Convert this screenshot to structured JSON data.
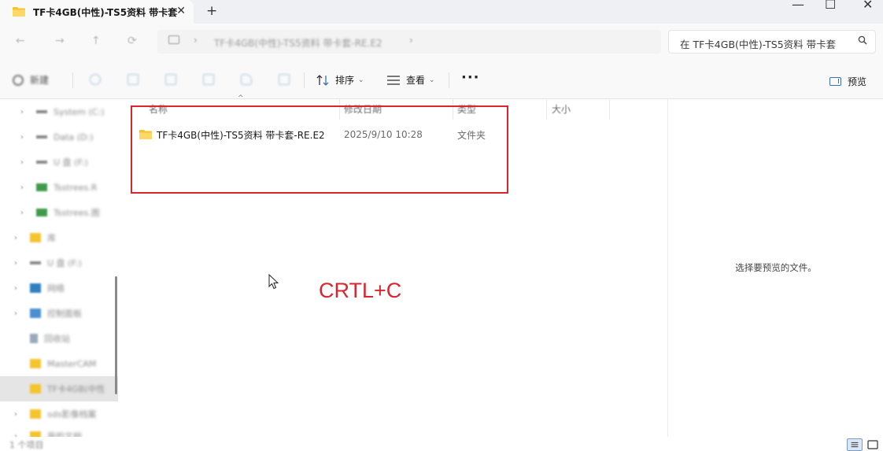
{
  "tab": {
    "title": "TF卡4GB(中性)-TS5资料 带卡套",
    "close": "✕",
    "new": "+"
  },
  "window_controls": {
    "minimize": "—",
    "maximize": "☐",
    "close": "✕"
  },
  "nav": {
    "back": "←",
    "forward": "→",
    "up": "↑",
    "refresh": "⟳"
  },
  "address": {
    "chevron": "›",
    "path": "TF卡4GB(中性)-TS5资料 带卡套-RE.E2"
  },
  "search": {
    "placeholder": "在 TF卡4GB(中性)-TS5资料 带卡套"
  },
  "toolbar": {
    "new_label": "新建",
    "sort_label": "排序",
    "view_label": "查看",
    "more_label": "···",
    "preview_label": "预览",
    "chevron": "⌄"
  },
  "sidebar": {
    "items": [
      {
        "label": "System (C:)"
      },
      {
        "label": "Data (D:)"
      },
      {
        "label": "U 盘 (F:)"
      },
      {
        "label": "Tsstrees.R"
      },
      {
        "label": "Tsstrees.图"
      },
      {
        "label": "库"
      },
      {
        "label": "U 盘 (F:)"
      },
      {
        "label": "网络"
      },
      {
        "label": "控制面板"
      },
      {
        "label": "回收站"
      },
      {
        "label": "MasterCAM"
      },
      {
        "label": "TF卡4GB(中性"
      },
      {
        "label": "sds影像档案"
      },
      {
        "label": "我的文档"
      }
    ]
  },
  "columns": {
    "name": "名称",
    "date": "修改日期",
    "type": "类型",
    "size": "大小",
    "sort_caret": "^"
  },
  "files": [
    {
      "name": "TF卡4GB(中性)-TS5资料 带卡套-RE.E2",
      "date": "2025/9/10 10:28",
      "type": "文件夹"
    }
  ],
  "annotation": "CRTL+C",
  "preview": {
    "empty_text": "选择要预览的文件。"
  },
  "status": {
    "count": "1 个项目"
  },
  "colors": {
    "accent": "#3a6fb0",
    "annotation": "#d9252e",
    "folder": "#f4c430"
  }
}
